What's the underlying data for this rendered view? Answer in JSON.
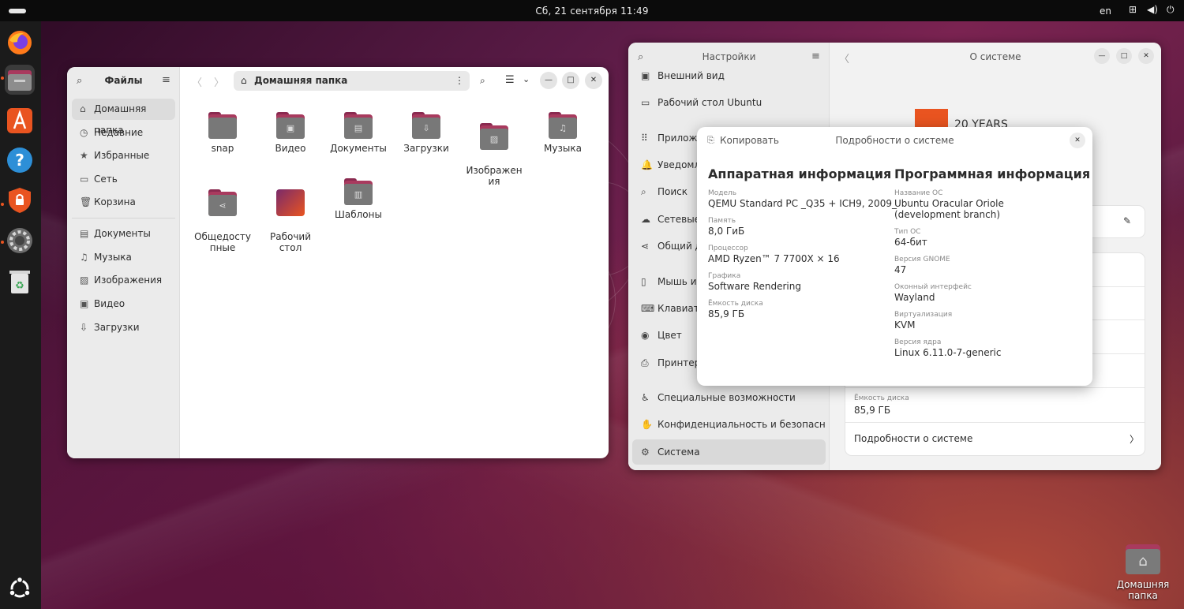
{
  "topbar": {
    "clock": "Сб, 21 сентября  11:49",
    "lang": "en"
  },
  "dock": [
    "firefox-icon",
    "files-icon",
    "app-center-icon",
    "help-icon",
    "security-center-icon",
    "settings-icon",
    "trash-icon",
    "show-apps-icon"
  ],
  "files": {
    "title": "Файлы",
    "path": "Домашняя папка",
    "sidebar": [
      "Домашняя папка",
      "Недавние",
      "Избранные",
      "Сеть",
      "Корзина",
      "Документы",
      "Музыка",
      "Изображения",
      "Видео",
      "Загрузки"
    ],
    "folders": [
      {
        "name": "snap",
        "icon": ""
      },
      {
        "name": "Видео",
        "icon": "▣"
      },
      {
        "name": "Документы",
        "icon": "▤"
      },
      {
        "name": "Загрузки",
        "icon": "⇩"
      },
      {
        "name": "Изображен\nия",
        "icon": "▨"
      },
      {
        "name": "Музыка",
        "icon": "♫"
      },
      {
        "name": "Общедосту\nпные",
        "icon": "⋖"
      },
      {
        "name": "Рабочий\nстол",
        "icon": ""
      },
      {
        "name": "Шаблоны",
        "icon": "▥"
      }
    ]
  },
  "settings": {
    "title": "Настройки",
    "page_title": "О системе",
    "sidebar": [
      "Внешний вид",
      "Рабочий стол Ubuntu",
      "Приложе",
      "Уведомле",
      "Поиск",
      "Сетевые в",
      "Общий до",
      "Мышь и с",
      "Клавиату",
      "Цвет",
      "Принтеры",
      "Специальные возможности",
      "Конфиденциальность и безопасность",
      "Система"
    ],
    "logo_text": "20 YEARS",
    "disk_label": "Ёмкость диска",
    "disk_value": "85,9 ГБ",
    "details_link": "Подробности о системе"
  },
  "dialog": {
    "copy": "Копировать",
    "title": "Подробности о системе",
    "hw_heading": "Аппаратная информация",
    "sw_heading": "Программная информация",
    "hw": [
      {
        "label": "Модель",
        "value": "QEMU Standard PC _Q35 + ICH9, 2009_"
      },
      {
        "label": "Память",
        "value": "8,0 ГиБ"
      },
      {
        "label": "Процессор",
        "value": "AMD Ryzen™ 7 7700X × 16"
      },
      {
        "label": "Графика",
        "value": "Software Rendering"
      },
      {
        "label": "Ёмкость диска",
        "value": "85,9 ГБ"
      }
    ],
    "sw": [
      {
        "label": "Название ОС",
        "value": "Ubuntu Oracular Oriole\n(development branch)"
      },
      {
        "label": "Тип ОС",
        "value": "64-бит"
      },
      {
        "label": "Версия GNOME",
        "value": "47"
      },
      {
        "label": "Оконный интерфейс",
        "value": "Wayland"
      },
      {
        "label": "Виртуализация",
        "value": "KVM"
      },
      {
        "label": "Версия ядра",
        "value": "Linux 6.11.0-7-generic"
      }
    ]
  },
  "desktop": {
    "home_label": "Домашняя папка"
  }
}
